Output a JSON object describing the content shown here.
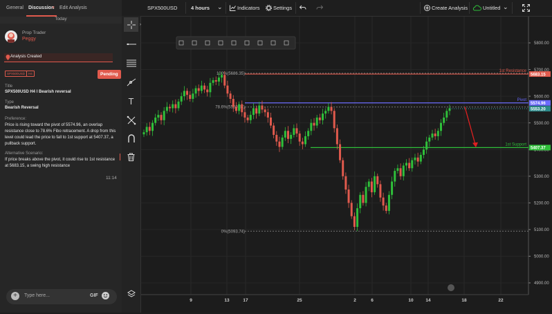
{
  "left_panel": {
    "tabs": [
      "General",
      "Discussion",
      "Edit Analysis"
    ],
    "discussion_close": "×",
    "date_divider": "Today",
    "author_role": "Prop Trader",
    "author_name": "Peggy",
    "status_banner": "Analysis Created",
    "symbol_tag": "SPX500USD",
    "timeframe_tag": "H4",
    "pending_label": "Pending",
    "title_label": "Title",
    "title_value": "SPX500USD H4 I Bearish reversal",
    "type_label": "Type",
    "type_value": "Bearish Reversal",
    "preference_label": "Preference:",
    "preference_text": "Price is rising toward the pivot of 5574.96, an overlap resistance close to 78.6% Fibo retracement. A drop from this level could lead the price to fall to 1st support at 5407.37, a pullback support.",
    "alt_label": "Alternative Scenario:",
    "alt_text": "If price breaks above the pivot, it could rise to 1st resistance at 5683.15, a swing high resistance",
    "time": "11:14",
    "input_placeholder": "Type here...",
    "gif_label": "GIF"
  },
  "topbar": {
    "symbol": "SPX500USD",
    "interval": "4 hours",
    "indicators": "Indicators",
    "settings": "Settings",
    "create_analysis": "Create Analysis",
    "layout_name": "Untitled"
  },
  "colors": {
    "accent": "#e15a4d",
    "resistance": "#e15a4d",
    "pivot": "#6b6bff",
    "support": "#2fbf3a",
    "up_candle": "#2fbf3a",
    "down_candle": "#e15a4d"
  },
  "chart_data": {
    "type": "candlestick",
    "y_ticks": [
      "5800.00",
      "5700.00",
      "5600.00",
      "5500.00",
      "5400.00",
      "5300.00",
      "5200.00",
      "5100.00",
      "5000.00",
      "4900.00"
    ],
    "y_range": [
      4850,
      5850
    ],
    "x_ticks": [
      "9",
      "13",
      "17",
      "25",
      "2",
      "6",
      "10",
      "14",
      "18",
      "22"
    ],
    "levels": [
      {
        "name": "1st Resistance",
        "value": 5683.15,
        "label": "5683.15",
        "color": "#e15a4d"
      },
      {
        "name": "Pivot",
        "value": 5574.96,
        "label": "5574.96",
        "color": "#6b6bff"
      },
      {
        "name": "1st Support",
        "value": 5407.37,
        "label": "5407.37",
        "color": "#2fbf3a"
      }
    ],
    "price_label": "5553.20",
    "fib_levels": [
      {
        "label": "100%(5686.35)",
        "value": 5686.35
      },
      {
        "label": "78.6%(5559.54)",
        "value": 5559.54
      },
      {
        "label": "0%(5093.74)",
        "value": 5093.74
      }
    ],
    "closes": [
      5465,
      5485,
      5470,
      5500,
      5520,
      5530,
      5510,
      5545,
      5560,
      5555,
      5570,
      5555,
      5580,
      5600,
      5620,
      5605,
      5590,
      5610,
      5630,
      5620,
      5640,
      5625,
      5615,
      5650,
      5660,
      5655,
      5670,
      5680,
      5640,
      5610,
      5590,
      5560,
      5545,
      5570,
      5540,
      5520,
      5510,
      5530,
      5555,
      5535,
      5565,
      5550,
      5540,
      5520,
      5490,
      5455,
      5430,
      5410,
      5445,
      5470,
      5440,
      5455,
      5480,
      5460,
      5430,
      5420,
      5450,
      5470,
      5500,
      5490,
      5520,
      5510,
      5535,
      5545,
      5560,
      5545,
      5480,
      5420,
      5360,
      5300,
      5250,
      5200,
      5150,
      5110,
      5180,
      5230,
      5200,
      5260,
      5280,
      5240,
      5300,
      5270,
      5220,
      5190,
      5170,
      5230,
      5280,
      5320,
      5330,
      5300,
      5340,
      5350,
      5330,
      5360,
      5370,
      5355,
      5380,
      5400,
      5430,
      5445,
      5460,
      5450,
      5470,
      5500,
      5520,
      5545,
      5555
    ]
  }
}
